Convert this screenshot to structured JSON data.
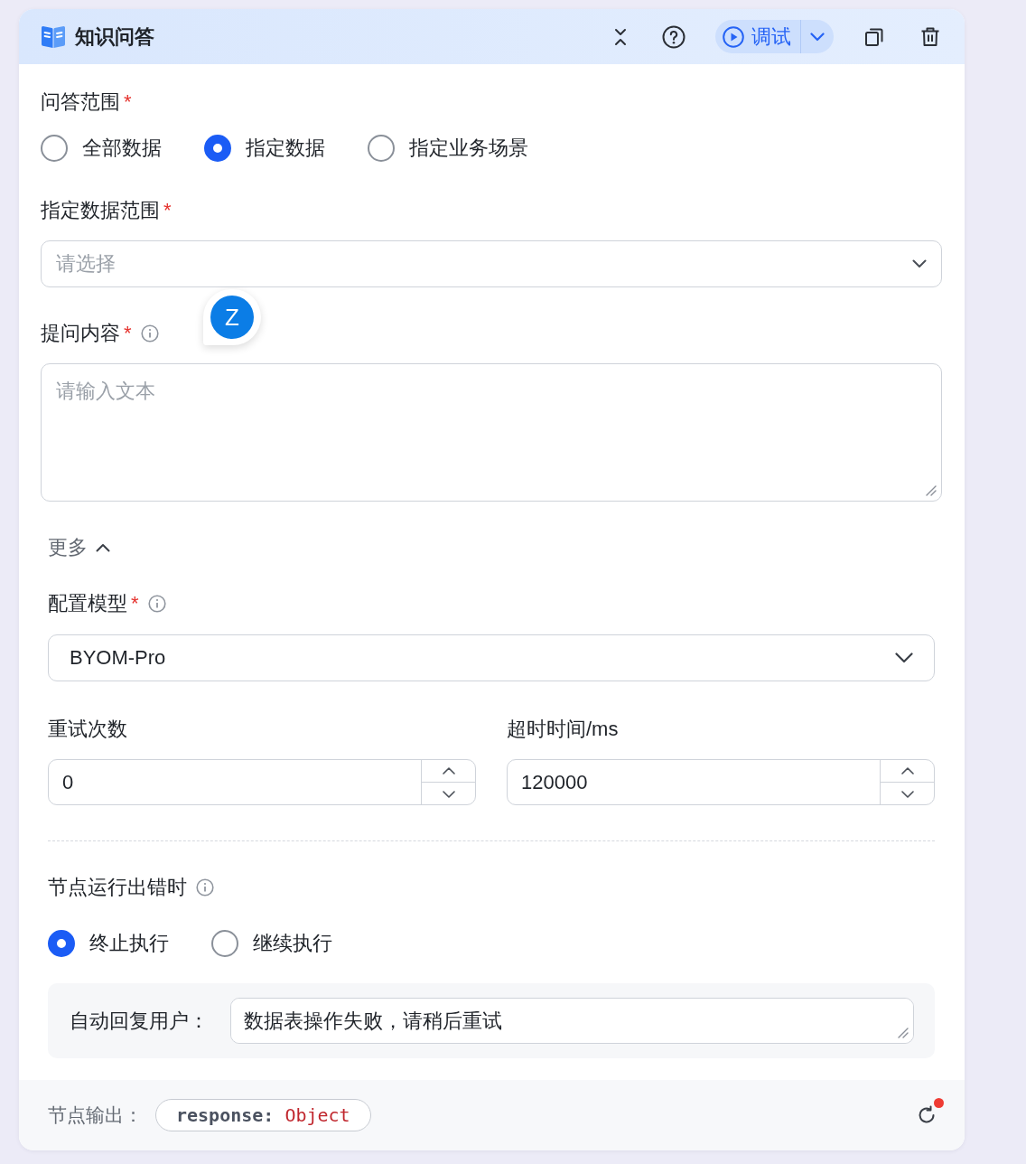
{
  "header": {
    "title": "知识问答",
    "debug_label": "调试"
  },
  "qa_scope": {
    "label": "问答范围",
    "required_mark": "*",
    "options": [
      {
        "label": "全部数据",
        "selected": false
      },
      {
        "label": "指定数据",
        "selected": true
      },
      {
        "label": "指定业务场景",
        "selected": false
      }
    ]
  },
  "data_scope": {
    "label": "指定数据范围",
    "required_mark": "*",
    "placeholder": "请选择"
  },
  "question": {
    "label": "提问内容",
    "required_mark": "*",
    "info": true,
    "placeholder": "请输入文本"
  },
  "more": {
    "label": "更多",
    "expanded": true
  },
  "model": {
    "label": "配置模型",
    "required_mark": "*",
    "info": true,
    "value": "BYOM-Pro"
  },
  "limits": [
    {
      "label": "重试次数",
      "value": "0"
    },
    {
      "label": "超时时间/ms",
      "value": "120000"
    }
  ],
  "on_error": {
    "label": "节点运行出错时",
    "info": true,
    "options": [
      {
        "label": "终止执行",
        "selected": true
      },
      {
        "label": "继续执行",
        "selected": false
      }
    ],
    "reply_label": "自动回复用户：",
    "reply_value": "数据表操作失败，请稍后重试"
  },
  "output": {
    "label": "节点输出：",
    "field_name": "response:",
    "field_type": "Object",
    "badge": true
  },
  "assistant_bubble": {
    "letter": "Z"
  }
}
